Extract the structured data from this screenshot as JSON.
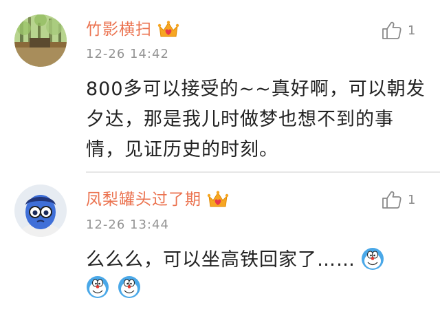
{
  "comments": [
    {
      "username": "竹影横扫",
      "time": "12-26 14:42",
      "likes": "1",
      "text": "800多可以接受的~~真好啊，可以朝发夕达，那是我儿时做梦也想不到的事情，见证历史的时刻。",
      "avatar_icon": "bamboo-garden-avatar-icon",
      "badge_icon": "vip-crown-heart-icon"
    },
    {
      "username": "凤梨罐头过了期",
      "time": "12-26 13:44",
      "likes": "1",
      "text": "么么么，可以坐高铁回家了……",
      "avatar_icon": "blue-cartoon-character-avatar-icon",
      "badge_icon": "vip-crown-heart-icon",
      "emojis": [
        "doraemon-emoji-icon",
        "doraemon-emoji-icon",
        "doraemon-emoji-icon"
      ]
    }
  ],
  "colors": {
    "username": "#eb7350",
    "time": "#939393",
    "text": "#222222",
    "divider": "#e6e6e6"
  }
}
